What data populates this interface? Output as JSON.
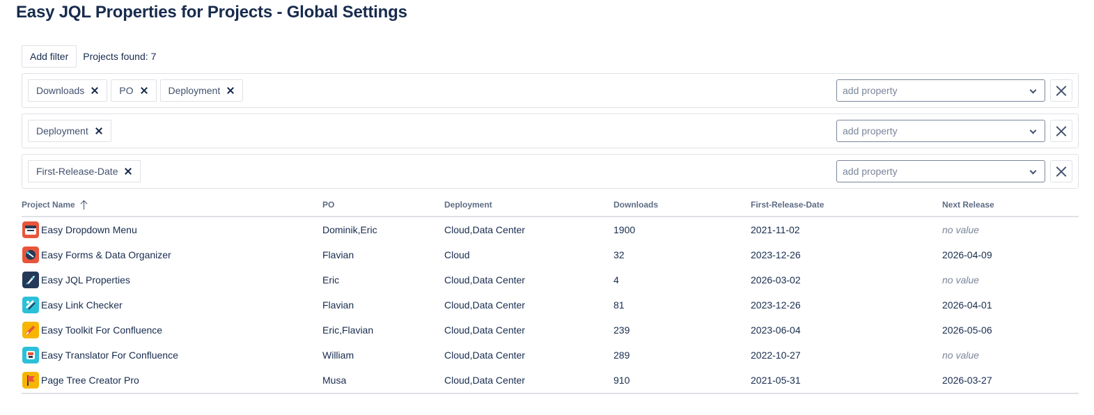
{
  "page": {
    "title": "Easy JQL Properties for Projects - Global Settings"
  },
  "toolbar": {
    "add_filter_label": "Add filter",
    "projects_found_label": "Projects found:",
    "projects_found_count": "7"
  },
  "filters": [
    {
      "chips": [
        "Downloads",
        "PO",
        "Deployment"
      ],
      "select_placeholder": "add property"
    },
    {
      "chips": [
        "Deployment"
      ],
      "select_placeholder": "add property"
    },
    {
      "chips": [
        "First-Release-Date"
      ],
      "select_placeholder": "add property"
    }
  ],
  "table": {
    "columns": [
      "Project Name",
      "PO",
      "Deployment",
      "Downloads",
      "First-Release-Date",
      "Next Release"
    ],
    "sort_column": "Project Name",
    "sort_direction": "ascending",
    "rows": [
      {
        "name": "Easy Dropdown Menu",
        "icon": "dropdown-menu-app-icon",
        "icon_color": "#e8553b",
        "po": "Dominik,Eric",
        "deployment": "Cloud,Data Center",
        "downloads": "1900",
        "first_release": "2021-11-02",
        "next_release": "no value"
      },
      {
        "name": "Easy Forms & Data Organizer",
        "icon": "forms-app-icon",
        "icon_color": "#e8553b",
        "po": "Flavian",
        "deployment": "Cloud",
        "downloads": "32",
        "first_release": "2023-12-26",
        "next_release": "2026-04-09"
      },
      {
        "name": "Easy JQL Properties",
        "icon": "rocket-app-icon",
        "icon_color": "#253858",
        "po": "Eric",
        "deployment": "Cloud,Data Center",
        "downloads": "4",
        "first_release": "2026-03-02",
        "next_release": "no value"
      },
      {
        "name": "Easy Link Checker",
        "icon": "link-checker-app-icon",
        "icon_color": "#2bc0d8",
        "po": "Flavian",
        "deployment": "Cloud,Data Center",
        "downloads": "81",
        "first_release": "2023-12-26",
        "next_release": "2026-04-01"
      },
      {
        "name": "Easy Toolkit For Confluence",
        "icon": "toolkit-app-icon",
        "icon_color": "#f7b500",
        "po": "Eric,Flavian",
        "deployment": "Cloud,Data Center",
        "downloads": "239",
        "first_release": "2023-06-04",
        "next_release": "2026-05-06"
      },
      {
        "name": "Easy Translator For Confluence",
        "icon": "translator-app-icon",
        "icon_color": "#2bc0d8",
        "po": "William",
        "deployment": "Cloud,Data Center",
        "downloads": "289",
        "first_release": "2022-10-27",
        "next_release": "no value"
      },
      {
        "name": "Page Tree Creator Pro",
        "icon": "page-tree-app-icon",
        "icon_color": "#f7b500",
        "po": "Musa",
        "deployment": "Cloud,Data Center",
        "downloads": "910",
        "first_release": "2021-05-31",
        "next_release": "2026-03-27"
      }
    ]
  }
}
